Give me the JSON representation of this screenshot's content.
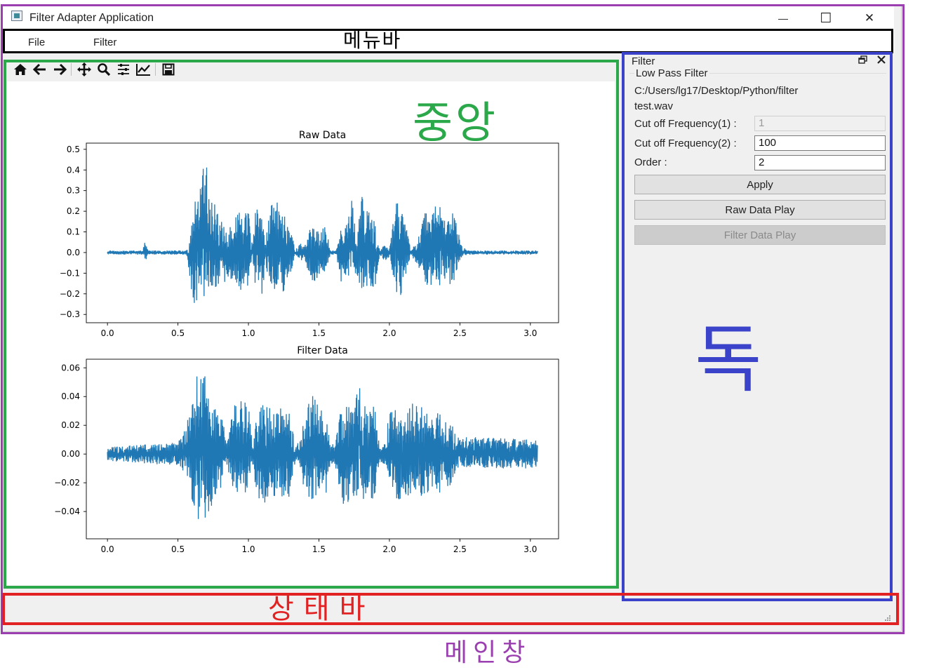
{
  "window": {
    "title": "Filter Adapter Application",
    "controls": {
      "minimize": "—",
      "maximize": "☐",
      "close": "✕"
    }
  },
  "menubar": {
    "items": [
      "File",
      "Filter"
    ]
  },
  "toolbar": {
    "icons": [
      "home-icon",
      "back-icon",
      "forward-icon",
      "pan-icon",
      "zoom-icon",
      "configure-subplots-icon",
      "edit-axis-icon",
      "save-icon"
    ]
  },
  "chart_data": [
    {
      "type": "line",
      "title": "Raw Data",
      "xlabel": "",
      "ylabel": "",
      "xlim": [
        -0.15,
        3.2
      ],
      "ylim": [
        -0.34,
        0.53
      ],
      "xticks": [
        "0.0",
        "0.5",
        "1.0",
        "1.5",
        "2.0",
        "2.5",
        "3.0"
      ],
      "yticks": [
        "0.5",
        "0.4",
        "0.3",
        "0.2",
        "0.1",
        "0.0",
        "−0.1",
        "−0.2",
        "−0.3"
      ],
      "color": "#1f77b4",
      "envelope": {
        "t": [
          0.0,
          0.25,
          0.27,
          0.29,
          0.56,
          0.58,
          0.6,
          0.62,
          0.65,
          0.7,
          0.72,
          0.75,
          0.8,
          0.85,
          0.9,
          0.95,
          1.0,
          1.02,
          1.05,
          1.1,
          1.12,
          1.15,
          1.2,
          1.25,
          1.3,
          1.33,
          1.37,
          1.4,
          1.43,
          1.45,
          1.5,
          1.55,
          1.58,
          1.62,
          1.65,
          1.7,
          1.73,
          1.77,
          1.8,
          1.85,
          1.9,
          1.93,
          1.97,
          2.0,
          2.05,
          2.08,
          2.12,
          2.15,
          2.2,
          2.25,
          2.3,
          2.35,
          2.4,
          2.45,
          2.48,
          2.5,
          2.55,
          3.05
        ],
        "upper": [
          0.01,
          0.01,
          0.07,
          0.01,
          0.01,
          0.04,
          0.22,
          0.32,
          0.28,
          0.5,
          0.3,
          0.25,
          0.18,
          0.1,
          0.22,
          0.2,
          0.22,
          0.04,
          0.22,
          0.2,
          0.04,
          0.22,
          0.25,
          0.18,
          0.15,
          0.01,
          0.05,
          0.03,
          0.12,
          0.14,
          0.1,
          0.13,
          0.01,
          0.01,
          0.12,
          0.15,
          0.26,
          0.1,
          0.28,
          0.22,
          0.14,
          0.01,
          0.04,
          0.02,
          0.27,
          0.22,
          0.15,
          0.01,
          0.06,
          0.2,
          0.18,
          0.3,
          0.15,
          0.2,
          0.16,
          0.05,
          0.01,
          0.01
        ],
        "lower": [
          -0.01,
          -0.01,
          -0.04,
          -0.01,
          -0.01,
          -0.1,
          -0.25,
          -0.27,
          -0.2,
          -0.29,
          -0.23,
          -0.22,
          -0.18,
          -0.12,
          -0.2,
          -0.18,
          -0.2,
          -0.04,
          -0.18,
          -0.21,
          -0.04,
          -0.18,
          -0.21,
          -0.19,
          -0.1,
          -0.01,
          -0.05,
          -0.03,
          -0.11,
          -0.16,
          -0.12,
          -0.1,
          -0.01,
          -0.01,
          -0.15,
          -0.11,
          -0.12,
          -0.13,
          -0.2,
          -0.2,
          -0.16,
          -0.01,
          -0.05,
          -0.02,
          -0.19,
          -0.22,
          -0.1,
          -0.01,
          -0.06,
          -0.16,
          -0.16,
          -0.17,
          -0.13,
          -0.17,
          -0.08,
          -0.04,
          -0.01,
          -0.01
        ]
      }
    },
    {
      "type": "line",
      "title": "Filter Data",
      "xlabel": "",
      "ylabel": "",
      "xlim": [
        -0.15,
        3.2
      ],
      "ylim": [
        -0.059,
        0.066
      ],
      "xticks": [
        "0.0",
        "0.5",
        "1.0",
        "1.5",
        "2.0",
        "2.5",
        "3.0"
      ],
      "yticks": [
        "0.06",
        "0.04",
        "0.02",
        "0.00",
        "−0.02",
        "−0.04"
      ],
      "color": "#1f77b4",
      "envelope": {
        "t": [
          0.0,
          0.5,
          0.56,
          0.6,
          0.63,
          0.68,
          0.72,
          0.75,
          0.8,
          0.85,
          0.9,
          0.95,
          1.0,
          1.03,
          1.06,
          1.1,
          1.15,
          1.2,
          1.25,
          1.3,
          1.33,
          1.37,
          1.4,
          1.45,
          1.5,
          1.55,
          1.58,
          1.62,
          1.65,
          1.7,
          1.75,
          1.78,
          1.8,
          1.82,
          1.85,
          1.9,
          1.93,
          1.97,
          2.0,
          2.05,
          2.1,
          2.15,
          2.2,
          2.25,
          2.3,
          2.35,
          2.4,
          2.45,
          2.5,
          2.55,
          3.05
        ],
        "upper": [
          0.005,
          0.008,
          0.02,
          0.04,
          0.055,
          0.062,
          0.048,
          0.035,
          0.03,
          0.01,
          0.035,
          0.038,
          0.034,
          0.008,
          0.033,
          0.035,
          0.035,
          0.03,
          0.035,
          0.03,
          0.006,
          0.01,
          0.028,
          0.042,
          0.035,
          0.03,
          0.006,
          0.01,
          0.028,
          0.035,
          0.032,
          0.064,
          0.03,
          0.035,
          0.03,
          0.035,
          0.005,
          0.008,
          0.03,
          0.034,
          0.02,
          0.035,
          0.04,
          0.03,
          0.025,
          0.03,
          0.025,
          0.02,
          0.01,
          0.012,
          0.01
        ],
        "lower": [
          -0.005,
          -0.008,
          -0.015,
          -0.034,
          -0.048,
          -0.052,
          -0.04,
          -0.035,
          -0.025,
          -0.01,
          -0.03,
          -0.03,
          -0.03,
          -0.008,
          -0.032,
          -0.035,
          -0.035,
          -0.03,
          -0.03,
          -0.032,
          -0.006,
          -0.01,
          -0.03,
          -0.033,
          -0.03,
          -0.028,
          -0.006,
          -0.01,
          -0.035,
          -0.035,
          -0.03,
          -0.03,
          -0.03,
          -0.034,
          -0.033,
          -0.03,
          -0.005,
          -0.008,
          -0.028,
          -0.035,
          -0.03,
          -0.035,
          -0.03,
          -0.03,
          -0.025,
          -0.03,
          -0.025,
          -0.02,
          -0.01,
          -0.01,
          -0.01
        ]
      }
    }
  ],
  "dock": {
    "title": "Filter",
    "group_title": "Low Pass Filter",
    "file_path_line1": "C:/Users/lg17/Desktop/Python/filter",
    "file_path_line2": "test.wav",
    "fields": [
      {
        "label": "Cut off Frequency(1) :",
        "value": "1",
        "enabled": false
      },
      {
        "label": "Cut off Frequency(2) :",
        "value": "100",
        "enabled": true
      },
      {
        "label": "Order :",
        "value": "2",
        "enabled": true
      }
    ],
    "buttons": [
      {
        "label": "Apply",
        "enabled": true
      },
      {
        "label": "Raw Data Play",
        "enabled": true
      },
      {
        "label": "Filter Data Play",
        "enabled": false
      }
    ],
    "float_icon": "float-icon",
    "close_icon": "close-icon"
  },
  "annotations": {
    "menubar": {
      "text": "메뉴바",
      "color": "#000000"
    },
    "central": {
      "text": "중앙",
      "color": "#2aa84a"
    },
    "dock": {
      "text": "독",
      "color": "#3a43c9"
    },
    "statusbar": {
      "text": "상태바",
      "color": "#e22222"
    },
    "mainwindow": {
      "text": "메인창",
      "color": "#9b3fb0"
    }
  }
}
